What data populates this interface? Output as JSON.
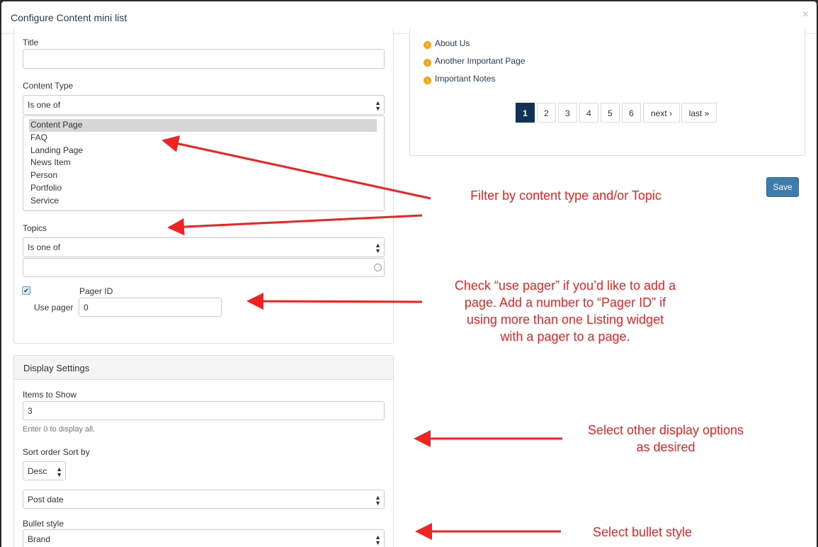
{
  "modal": {
    "title": "Configure Content mini list",
    "close": "×"
  },
  "filter": {
    "title_label": "Title",
    "title_value": "",
    "content_type_label": "Content Type",
    "content_type_operator": "Is one of",
    "content_type_options": [
      "Content Page",
      "FAQ",
      "Landing Page",
      "News Item",
      "Person",
      "Portfolio",
      "Service"
    ],
    "content_type_selected": "Content Page",
    "topics_label": "Topics",
    "topics_operator": "Is one of",
    "topics_value": "",
    "use_pager_checked": true,
    "use_pager_label": "Use pager",
    "pager_id_label": "Pager ID",
    "pager_id_value": "0"
  },
  "display": {
    "section_title": "Display Settings",
    "items_label": "Items to Show",
    "items_value": "3",
    "items_help": "Enter 0 to display all.",
    "sort_label": "Sort order Sort by",
    "sort_order": "Desc",
    "sort_by": "Post date",
    "bullet_label": "Bullet style",
    "bullet_value": "Brand"
  },
  "preview": {
    "items": [
      "About Us",
      "Another Important Page",
      "Important Notes"
    ],
    "pager": {
      "pages": [
        "1",
        "2",
        "3",
        "4",
        "5",
        "6"
      ],
      "active": "1",
      "next": "next ›",
      "last": "last »"
    }
  },
  "actions": {
    "save": "Save"
  },
  "annotations": {
    "filter": "Filter by content type and/or Topic",
    "pager_lines": [
      "Check “use pager” if you’d like to add a",
      "page. Add a number to “Pager ID” if",
      "using more than one Listing widget",
      "with a pager to a page."
    ],
    "display_lines": [
      "Select other display options",
      "as desired"
    ],
    "bullet": "Select bullet style"
  },
  "colors": {
    "annotation": "#f02222",
    "active_page": "#123356",
    "save_button": "#3e7cae",
    "bullet": "#f0a81c"
  }
}
